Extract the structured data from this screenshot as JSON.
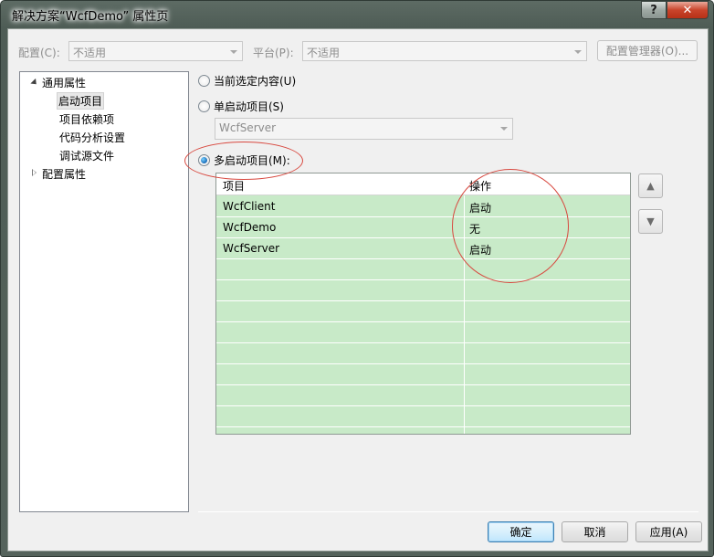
{
  "window": {
    "title": "解决方案“WcfDemo” 属性页",
    "help_glyph": "?",
    "close_glyph": "✕"
  },
  "top_bar": {
    "config_label": "配置(C):",
    "config_value": "不适用",
    "platform_label": "平台(P):",
    "platform_value": "不适用",
    "config_manager_label": "配置管理器(O)..."
  },
  "tree": {
    "root_common": "通用属性",
    "children": [
      "启动项目",
      "项目依赖项",
      "代码分析设置",
      "调试源文件"
    ],
    "root_config": "配置属性"
  },
  "startup": {
    "current_selection_label": "当前选定内容(U)",
    "single_label": "单启动项目(S)",
    "single_value": "WcfServer",
    "multi_label": "多启动项目(M):"
  },
  "grid": {
    "col_project": "项目",
    "col_action": "操作",
    "rows": [
      {
        "project": "WcfClient",
        "action": "启动"
      },
      {
        "project": "WcfDemo",
        "action": "无"
      },
      {
        "project": "WcfServer",
        "action": "启动"
      }
    ]
  },
  "move": {
    "up_glyph": "▲",
    "down_glyph": "▼"
  },
  "footer": {
    "ok_label": "确定",
    "cancel_label": "取消",
    "apply_label": "应用(A)"
  },
  "colors": {
    "grid_background": "#c8eac8",
    "annotation_ellipse": "#d8483f",
    "default_button_border": "#3c7fb1"
  }
}
